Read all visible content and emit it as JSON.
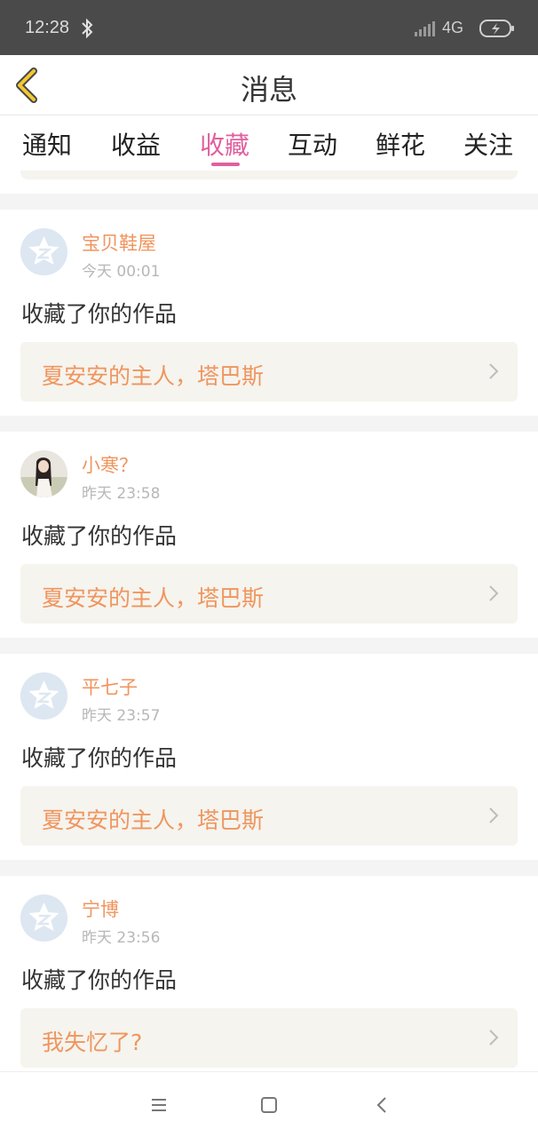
{
  "status_bar": {
    "time": "12:28",
    "network": "4G",
    "icons": [
      "bluetooth-icon",
      "signal-icon",
      "battery-icon"
    ]
  },
  "header": {
    "title": "消息",
    "back_icon": "back-chevron-icon"
  },
  "tabs": [
    {
      "label": "通知",
      "active": false
    },
    {
      "label": "收益",
      "active": false
    },
    {
      "label": "收藏",
      "active": true
    },
    {
      "label": "互动",
      "active": false
    },
    {
      "label": "鲜花",
      "active": false
    },
    {
      "label": "关注",
      "active": false
    }
  ],
  "notifications": [
    {
      "user": "宝贝鞋屋",
      "time": "今天 00:01",
      "action": "收藏了你的作品",
      "work": "夏安安的主人，塔巴斯",
      "avatar": "default-avatar"
    },
    {
      "user": "小寒？",
      "time": "昨天 23:58",
      "action": "收藏了你的作品",
      "work": "夏安安的主人，塔巴斯",
      "avatar": "photo-avatar"
    },
    {
      "user": "平七子",
      "time": "昨天 23:57",
      "action": "收藏了你的作品",
      "work": "夏安安的主人，塔巴斯",
      "avatar": "default-avatar"
    },
    {
      "user": "宁博",
      "time": "昨天 23:56",
      "action": "收藏了你的作品",
      "work": "我失忆了?",
      "avatar": "default-avatar"
    }
  ],
  "nav_bar": [
    "menu-icon",
    "home-icon",
    "back-icon"
  ],
  "colors": {
    "accent_pink": "#e0609e",
    "username_orange": "#f0955e",
    "work_bg": "#f5f4ee",
    "back_icon_yellow": "#f3c92f"
  }
}
